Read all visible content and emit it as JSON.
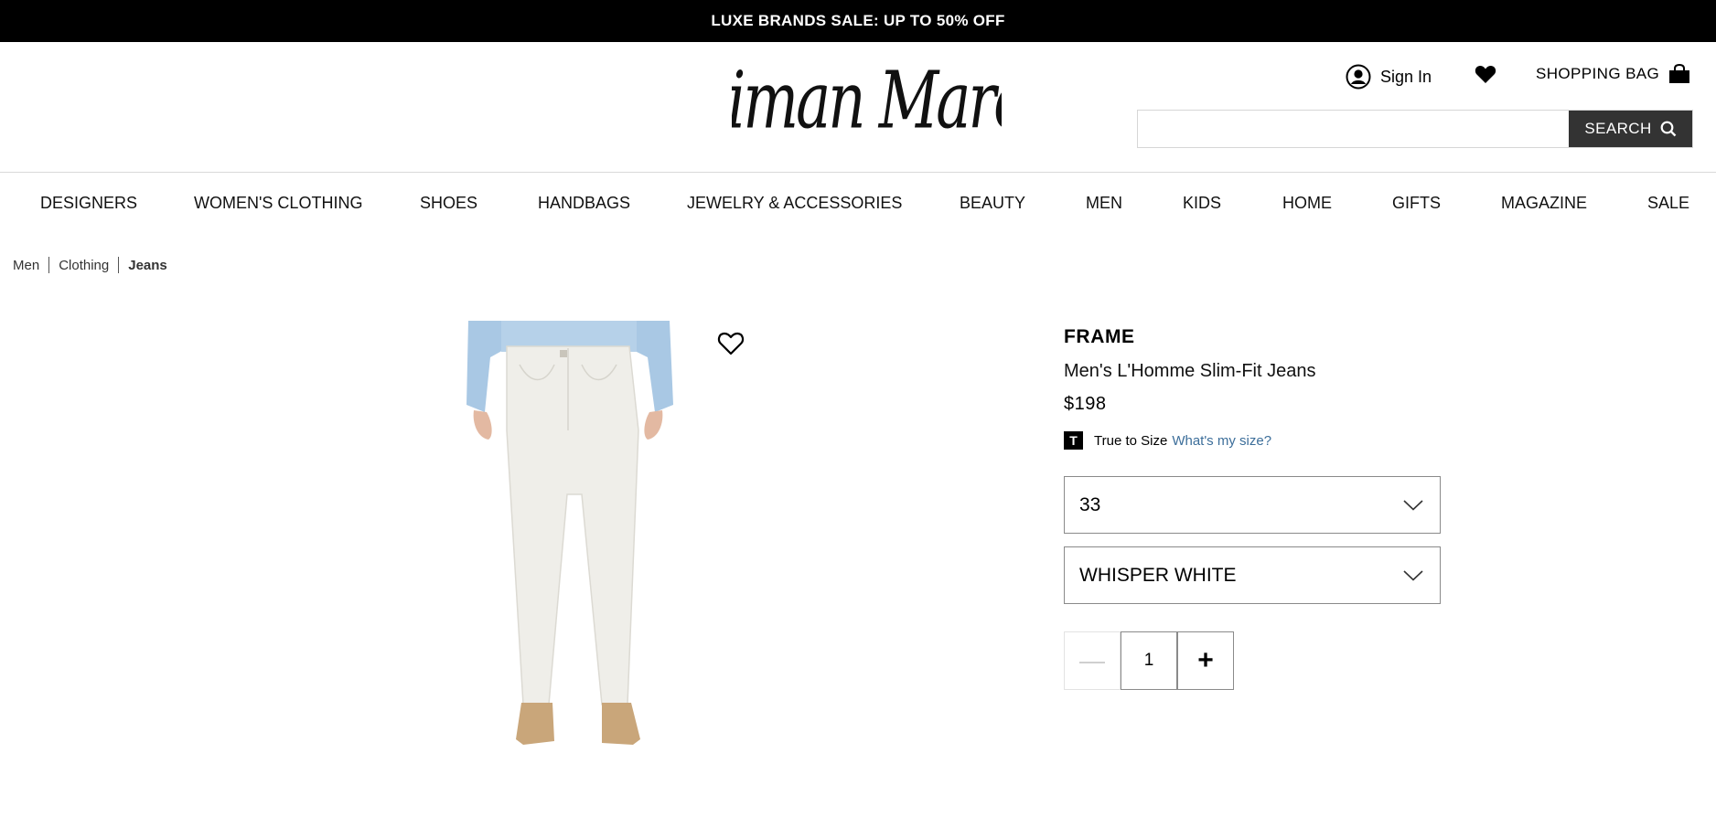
{
  "promo": {
    "text": "LUXE BRANDS SALE: UP TO 50% OFF"
  },
  "header": {
    "logo_text": "Neiman Marcus",
    "sign_in_label": "Sign In",
    "shopping_bag_label": "SHOPPING BAG",
    "search": {
      "placeholder": "",
      "button_label": "SEARCH"
    }
  },
  "nav": {
    "items": [
      {
        "label": "DESIGNERS"
      },
      {
        "label": "WOMEN'S CLOTHING"
      },
      {
        "label": "SHOES"
      },
      {
        "label": "HANDBAGS"
      },
      {
        "label": "JEWELRY & ACCESSORIES"
      },
      {
        "label": "BEAUTY"
      },
      {
        "label": "MEN"
      },
      {
        "label": "KIDS"
      },
      {
        "label": "HOME"
      },
      {
        "label": "GIFTS"
      },
      {
        "label": "MAGAZINE"
      },
      {
        "label": "SALE"
      }
    ]
  },
  "breadcrumb": {
    "items": [
      "Men",
      "Clothing",
      "Jeans"
    ]
  },
  "product": {
    "brand": "FRAME",
    "name": "Men's L'Homme Slim-Fit Jeans",
    "price": "$198",
    "fit_badge": "T",
    "fit_label": "True to Size",
    "fit_link": "What's my size?",
    "size_selected": "33",
    "color_selected": "WHISPER WHITE",
    "quantity": "1",
    "qty_minus": "—",
    "qty_plus": "+"
  },
  "colors": {
    "promo_bg": "#000000",
    "search_button_bg": "#333333",
    "link": "#3c6e9a",
    "shirt": "#a9c8e4",
    "jeans": "#efeee9",
    "boots": "#c9a67a"
  },
  "icons": [
    "user-icon",
    "heart-icon",
    "shopping-bag-icon",
    "search-icon",
    "wishlist-heart-icon",
    "chevron-down-icon"
  ]
}
